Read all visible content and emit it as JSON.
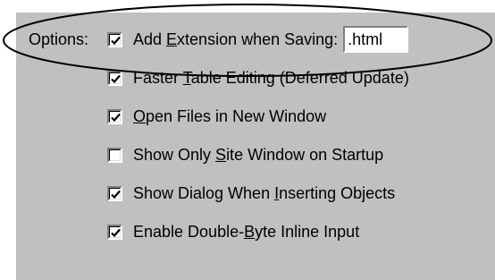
{
  "options_label": "Options:",
  "items": [
    {
      "pre": "Add ",
      "acc": "E",
      "post": "xtension when Saving:",
      "checked": true
    },
    {
      "pre": "Faster ",
      "acc": "T",
      "post": "able Editing (Deferred Update)",
      "checked": true
    },
    {
      "pre": "",
      "acc": "O",
      "post": "pen Files in New Window",
      "checked": true
    },
    {
      "pre": "Show Only ",
      "acc": "S",
      "post": "ite Window on Startup",
      "checked": false
    },
    {
      "pre": "Show Dialog When ",
      "acc": "I",
      "post": "nserting Objects",
      "checked": true
    },
    {
      "pre": "Enable Double-",
      "acc": "B",
      "post": "yte Inline Input",
      "checked": true
    }
  ],
  "extension_value": ".html",
  "colors": {
    "dialog_bg": "#c0c0c0",
    "highlight_ellipse": "#000000"
  },
  "icons": {
    "check": "checkmark-icon",
    "highlight": "ellipse-highlight"
  }
}
